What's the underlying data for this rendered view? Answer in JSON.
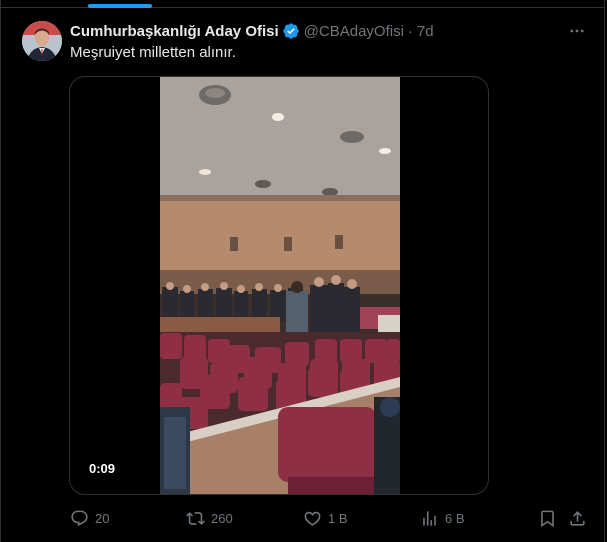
{
  "tweet": {
    "author_name": "Cumhurbaşkanlığı Aday Ofisi",
    "handle": "@CBAdayOfisi",
    "separator": "·",
    "timestamp": "7d",
    "text": "Meşruiyet milletten alınır.",
    "avatar_icon": "person-avatar",
    "verified_icon": "verified-badge-icon",
    "verified_color": "#1d9bf0"
  },
  "media": {
    "type": "video",
    "duration": "0:09",
    "scene": "courtroom with maroon chairs and uniformed officers"
  },
  "actions": {
    "replies": "20",
    "retweets": "260",
    "likes": "1 B",
    "views": "6 B"
  },
  "colors": {
    "background": "#000000",
    "text_primary": "#e7e9ea",
    "text_secondary": "#71767b",
    "accent": "#1d9bf0",
    "border": "#2f3336"
  }
}
